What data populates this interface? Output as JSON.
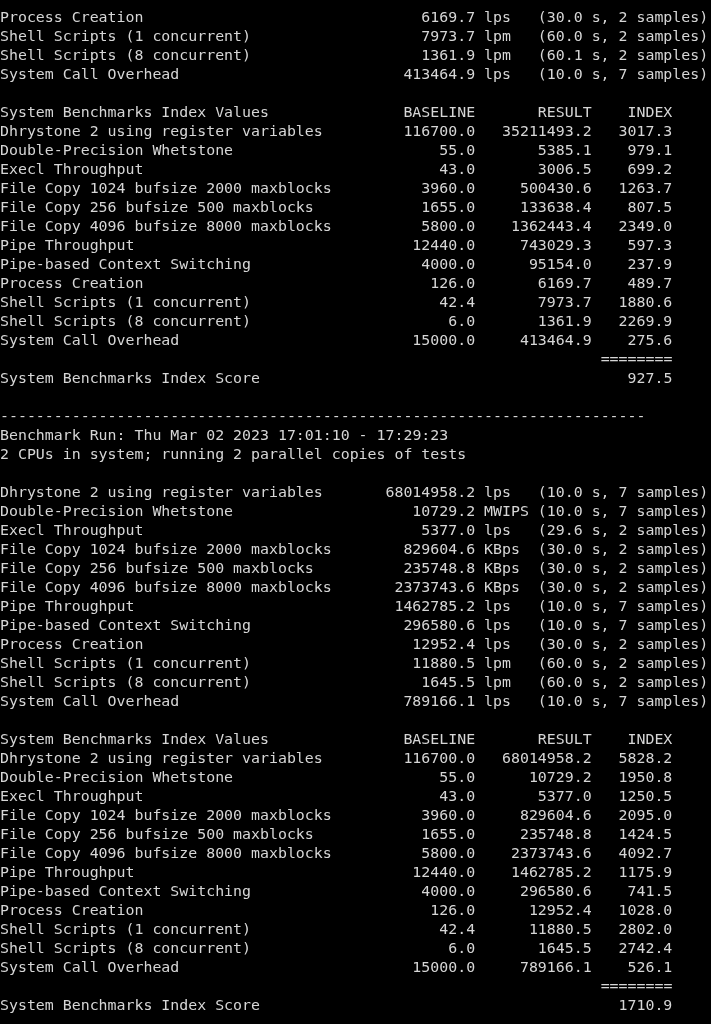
{
  "sections": [
    {
      "kind": "results",
      "rows": [
        {
          "name": "Process Creation",
          "value": "6169.7",
          "unit": "lps",
          "detail": "(30.0 s, 2 samples)"
        },
        {
          "name": "Shell Scripts (1 concurrent)",
          "value": "7973.7",
          "unit": "lpm",
          "detail": "(60.0 s, 2 samples)"
        },
        {
          "name": "Shell Scripts (8 concurrent)",
          "value": "1361.9",
          "unit": "lpm",
          "detail": "(60.1 s, 2 samples)"
        },
        {
          "name": "System Call Overhead",
          "value": "413464.9",
          "unit": "lps",
          "detail": "(10.0 s, 7 samples)"
        }
      ]
    },
    {
      "kind": "index",
      "header": {
        "title": "System Benchmarks Index Values",
        "baseline": "BASELINE",
        "result": "RESULT",
        "index": "INDEX"
      },
      "rows": [
        {
          "name": "Dhrystone 2 using register variables",
          "baseline": "116700.0",
          "result": "35211493.2",
          "index": "3017.3"
        },
        {
          "name": "Double-Precision Whetstone",
          "baseline": "55.0",
          "result": "5385.1",
          "index": "979.1"
        },
        {
          "name": "Execl Throughput",
          "baseline": "43.0",
          "result": "3006.5",
          "index": "699.2"
        },
        {
          "name": "File Copy 1024 bufsize 2000 maxblocks",
          "baseline": "3960.0",
          "result": "500430.6",
          "index": "1263.7"
        },
        {
          "name": "File Copy 256 bufsize 500 maxblocks",
          "baseline": "1655.0",
          "result": "133638.4",
          "index": "807.5"
        },
        {
          "name": "File Copy 4096 bufsize 8000 maxblocks",
          "baseline": "5800.0",
          "result": "1362443.4",
          "index": "2349.0"
        },
        {
          "name": "Pipe Throughput",
          "baseline": "12440.0",
          "result": "743029.3",
          "index": "597.3"
        },
        {
          "name": "Pipe-based Context Switching",
          "baseline": "4000.0",
          "result": "95154.0",
          "index": "237.9"
        },
        {
          "name": "Process Creation",
          "baseline": "126.0",
          "result": "6169.7",
          "index": "489.7"
        },
        {
          "name": "Shell Scripts (1 concurrent)",
          "baseline": "42.4",
          "result": "7973.7",
          "index": "1880.6"
        },
        {
          "name": "Shell Scripts (8 concurrent)",
          "baseline": "6.0",
          "result": "1361.9",
          "index": "2269.9"
        },
        {
          "name": "System Call Overhead",
          "baseline": "15000.0",
          "result": "413464.9",
          "index": "275.6"
        }
      ],
      "rule": "========",
      "score": {
        "label": "System Benchmarks Index Score",
        "value": "927.5"
      }
    },
    {
      "kind": "separator",
      "text": "------------------------------------------------------------------------"
    },
    {
      "kind": "info",
      "lines": [
        "Benchmark Run: Thu Mar 02 2023 17:01:10 - 17:29:23",
        "2 CPUs in system; running 2 parallel copies of tests"
      ]
    },
    {
      "kind": "results",
      "rows": [
        {
          "name": "Dhrystone 2 using register variables",
          "value": "68014958.2",
          "unit": "lps",
          "detail": "(10.0 s, 7 samples)"
        },
        {
          "name": "Double-Precision Whetstone",
          "value": "10729.2",
          "unit": "MWIPS",
          "detail": "(10.0 s, 7 samples)"
        },
        {
          "name": "Execl Throughput",
          "value": "5377.0",
          "unit": "lps",
          "detail": "(29.6 s, 2 samples)"
        },
        {
          "name": "File Copy 1024 bufsize 2000 maxblocks",
          "value": "829604.6",
          "unit": "KBps",
          "detail": "(30.0 s, 2 samples)"
        },
        {
          "name": "File Copy 256 bufsize 500 maxblocks",
          "value": "235748.8",
          "unit": "KBps",
          "detail": "(30.0 s, 2 samples)"
        },
        {
          "name": "File Copy 4096 bufsize 8000 maxblocks",
          "value": "2373743.6",
          "unit": "KBps",
          "detail": "(30.0 s, 2 samples)"
        },
        {
          "name": "Pipe Throughput",
          "value": "1462785.2",
          "unit": "lps",
          "detail": "(10.0 s, 7 samples)"
        },
        {
          "name": "Pipe-based Context Switching",
          "value": "296580.6",
          "unit": "lps",
          "detail": "(10.0 s, 7 samples)"
        },
        {
          "name": "Process Creation",
          "value": "12952.4",
          "unit": "lps",
          "detail": "(30.0 s, 2 samples)"
        },
        {
          "name": "Shell Scripts (1 concurrent)",
          "value": "11880.5",
          "unit": "lpm",
          "detail": "(60.0 s, 2 samples)"
        },
        {
          "name": "Shell Scripts (8 concurrent)",
          "value": "1645.5",
          "unit": "lpm",
          "detail": "(60.0 s, 2 samples)"
        },
        {
          "name": "System Call Overhead",
          "value": "789166.1",
          "unit": "lps",
          "detail": "(10.0 s, 7 samples)"
        }
      ]
    },
    {
      "kind": "index",
      "header": {
        "title": "System Benchmarks Index Values",
        "baseline": "BASELINE",
        "result": "RESULT",
        "index": "INDEX"
      },
      "rows": [
        {
          "name": "Dhrystone 2 using register variables",
          "baseline": "116700.0",
          "result": "68014958.2",
          "index": "5828.2"
        },
        {
          "name": "Double-Precision Whetstone",
          "baseline": "55.0",
          "result": "10729.2",
          "index": "1950.8"
        },
        {
          "name": "Execl Throughput",
          "baseline": "43.0",
          "result": "5377.0",
          "index": "1250.5"
        },
        {
          "name": "File Copy 1024 bufsize 2000 maxblocks",
          "baseline": "3960.0",
          "result": "829604.6",
          "index": "2095.0"
        },
        {
          "name": "File Copy 256 bufsize 500 maxblocks",
          "baseline": "1655.0",
          "result": "235748.8",
          "index": "1424.5"
        },
        {
          "name": "File Copy 4096 bufsize 8000 maxblocks",
          "baseline": "5800.0",
          "result": "2373743.6",
          "index": "4092.7"
        },
        {
          "name": "Pipe Throughput",
          "baseline": "12440.0",
          "result": "1462785.2",
          "index": "1175.9"
        },
        {
          "name": "Pipe-based Context Switching",
          "baseline": "4000.0",
          "result": "296580.6",
          "index": "741.5"
        },
        {
          "name": "Process Creation",
          "baseline": "126.0",
          "result": "12952.4",
          "index": "1028.0"
        },
        {
          "name": "Shell Scripts (1 concurrent)",
          "baseline": "42.4",
          "result": "11880.5",
          "index": "2802.0"
        },
        {
          "name": "Shell Scripts (8 concurrent)",
          "baseline": "6.0",
          "result": "1645.5",
          "index": "2742.4"
        },
        {
          "name": "System Call Overhead",
          "baseline": "15000.0",
          "result": "789166.1",
          "index": "526.1"
        }
      ],
      "rule": "========",
      "score": {
        "label": "System Benchmarks Index Score",
        "value": "1710.9"
      }
    }
  ]
}
